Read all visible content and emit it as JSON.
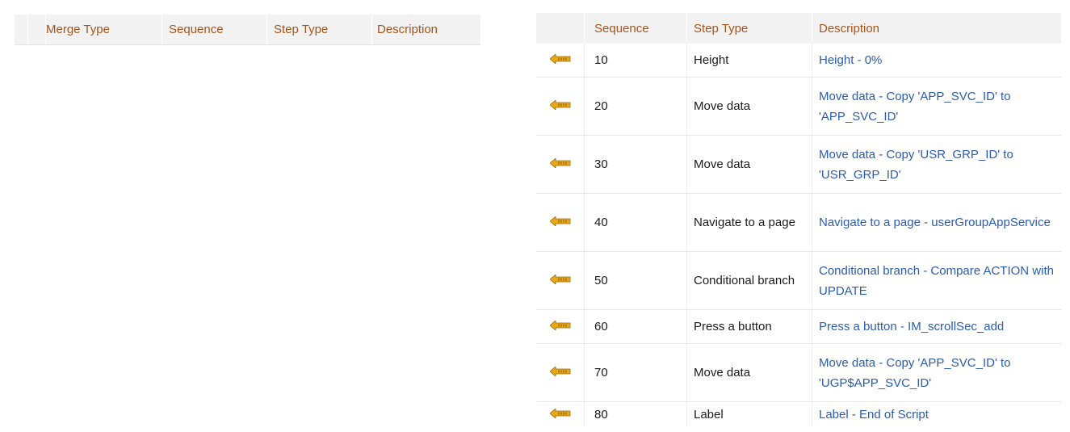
{
  "left_table": {
    "headers": [
      "Merge Type",
      "Sequence",
      "Step Type",
      "Description"
    ]
  },
  "right_table": {
    "headers": [
      "Sequence",
      "Step Type",
      "Description"
    ],
    "rows": [
      {
        "sequence": "10",
        "step_type": "Height",
        "description": "Height - 0%"
      },
      {
        "sequence": "20",
        "step_type": "Move data",
        "description": "Move data - Copy 'APP_SVC_ID' to 'APP_SVC_ID'"
      },
      {
        "sequence": "30",
        "step_type": "Move data",
        "description": "Move data - Copy 'USR_GRP_ID' to 'USR_GRP_ID'"
      },
      {
        "sequence": "40",
        "step_type": "Navigate to a page",
        "description": "Navigate to a page - userGroupAppService"
      },
      {
        "sequence": "50",
        "step_type": "Conditional branch",
        "description": "Conditional branch - Compare ACTION with UPDATE"
      },
      {
        "sequence": "60",
        "step_type": "Press a button",
        "description": "Press a button - IM_scrollSec_add"
      },
      {
        "sequence": "70",
        "step_type": "Move data",
        "description": "Move data - Copy 'APP_SVC_ID' to 'UGP$APP_SVC_ID'"
      },
      {
        "sequence": "80",
        "step_type": "Label",
        "description": "Label - End of Script"
      }
    ]
  },
  "colors": {
    "header_text": "#a5541b",
    "header_bg": "#f2f2f2",
    "link": "#2a5db0",
    "arrow": "#e8a817"
  },
  "icons": {
    "row_action": "move-left-arrow-icon"
  }
}
